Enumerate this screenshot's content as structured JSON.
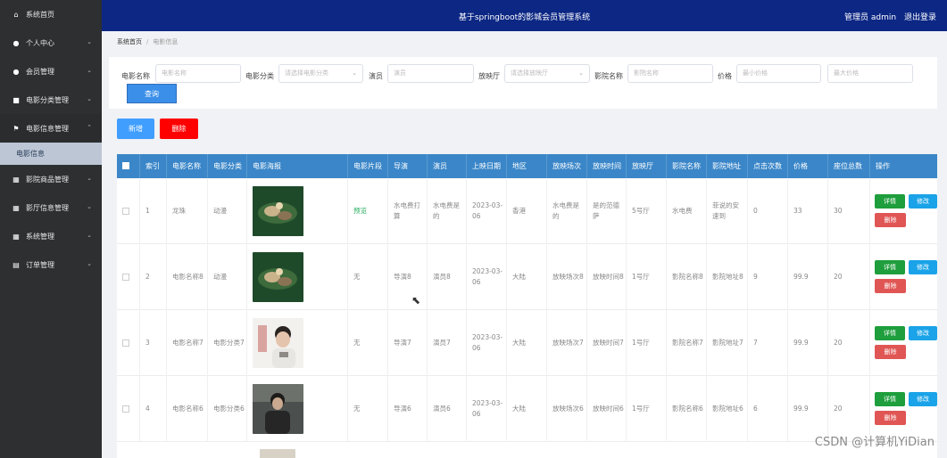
{
  "header": {
    "title": "基于springboot的影城会员管理系统",
    "user_label": "管理员 admin",
    "logout_label": "退出登录"
  },
  "sidebar": {
    "items": [
      {
        "label": "系统首页",
        "icon": "home-icon",
        "chevron": ""
      },
      {
        "label": "个人中心",
        "icon": "user-icon",
        "chevron": "⌄"
      },
      {
        "label": "会员管理",
        "icon": "users-icon",
        "chevron": "⌄"
      },
      {
        "label": "电影分类管理",
        "icon": "film-icon",
        "chevron": "⌄"
      },
      {
        "label": "电影信息管理",
        "icon": "flag-icon",
        "chevron": "⌃"
      },
      {
        "label": "影院商品管理",
        "icon": "grid-icon",
        "chevron": "⌄"
      },
      {
        "label": "影厅信息管理",
        "icon": "grid-icon",
        "chevron": "⌄"
      },
      {
        "label": "系统管理",
        "icon": "grid-icon",
        "chevron": "⌄"
      },
      {
        "label": "订单管理",
        "icon": "doc-icon",
        "chevron": "⌄"
      }
    ],
    "sub_item": "电影信息"
  },
  "breadcrumb": {
    "home": "系统首页",
    "sep": "/",
    "current": "电影信息"
  },
  "search": {
    "fields": [
      {
        "label": "电影名称",
        "placeholder": "电影名称"
      },
      {
        "label": "电影分类",
        "placeholder": "请选择电影分类"
      },
      {
        "label": "演员",
        "placeholder": "演员"
      },
      {
        "label": "放映厅",
        "placeholder": "请选择放映厅"
      },
      {
        "label": "影院名称",
        "placeholder": "影院名称"
      },
      {
        "label": "价格",
        "placeholder": "最小价格"
      },
      {
        "label": "",
        "placeholder": "最大价格"
      }
    ],
    "search_label": "查询"
  },
  "actions": {
    "add_label": "新增",
    "delete_label": "删除"
  },
  "table": {
    "headers": [
      "索引",
      "电影名称",
      "电影分类",
      "电影海报",
      "电影片段",
      "导演",
      "演员",
      "上映日期",
      "地区",
      "放映场次",
      "放映时间",
      "放映厅",
      "影院名称",
      "影院地址",
      "点击次数",
      "价格",
      "座位总数",
      "操作"
    ],
    "rows": [
      {
        "idx": "1",
        "name": "龙珠",
        "category": "动漫",
        "clip": "预览",
        "director": "水电费打算",
        "actor": "水电费是的",
        "date": "2023-03-06",
        "region": "香港",
        "session": "水电费是的",
        "time": "是的范德萨",
        "hall": "5号厅",
        "cinema": "水电费",
        "address": "菲说的安速到",
        "clicks": "0",
        "price": "33",
        "seats": "30"
      },
      {
        "idx": "2",
        "name": "电影名称8",
        "category": "动漫",
        "clip": "无",
        "director": "导演8",
        "actor": "演员8",
        "date": "2023-03-06",
        "region": "大陆",
        "session": "放映场次8",
        "time": "放映时间8",
        "hall": "1号厅",
        "cinema": "影院名称8",
        "address": "影院地址8",
        "clicks": "9",
        "price": "99.9",
        "seats": "20"
      },
      {
        "idx": "3",
        "name": "电影名称7",
        "category": "电影分类7",
        "clip": "无",
        "director": "导演7",
        "actor": "演员7",
        "date": "2023-03-06",
        "region": "大陆",
        "session": "放映场次7",
        "time": "放映时间7",
        "hall": "1号厅",
        "cinema": "影院名称7",
        "address": "影院地址7",
        "clicks": "7",
        "price": "99.9",
        "seats": "20"
      },
      {
        "idx": "4",
        "name": "电影名称6",
        "category": "电影分类6",
        "clip": "无",
        "director": "导演6",
        "actor": "演员6",
        "date": "2023-03-06",
        "region": "大陆",
        "session": "放映场次6",
        "time": "放映时间6",
        "hall": "1号厅",
        "cinema": "影院名称6",
        "address": "影院地址6",
        "clicks": "6",
        "price": "99.9",
        "seats": "20"
      }
    ],
    "op_detail": "详情",
    "op_edit": "修改",
    "op_delete": "删除"
  },
  "watermark": "CSDN @计算机YiDian",
  "colors": {
    "topbar": "#0c2784",
    "sidebar": "#2d2f31",
    "table_header": "#3a86c8",
    "add": "#409eff",
    "delete": "#ff0000"
  }
}
